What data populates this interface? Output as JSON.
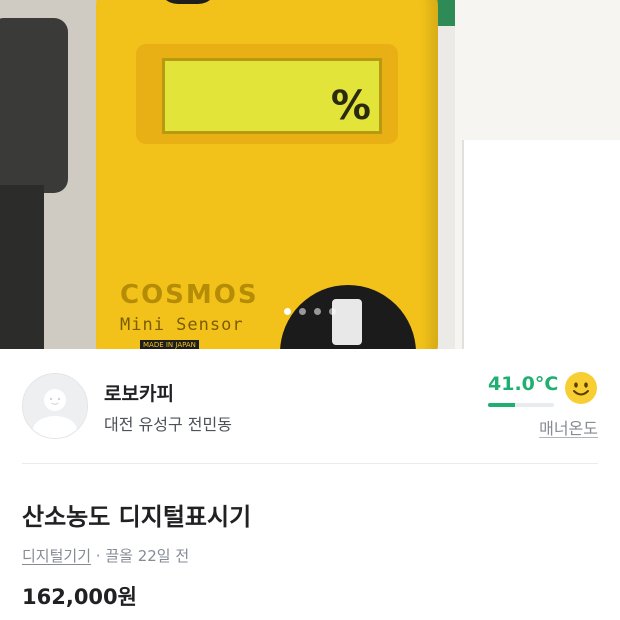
{
  "photo": {
    "device_brand": "COSMOS",
    "device_model": "Mini Sensor",
    "device_made": "MADE IN JAPAN",
    "lcd_unit": "%",
    "carousel_total": 4,
    "carousel_active_index": 0
  },
  "seller": {
    "nickname": "로보카피",
    "location": "대전 유성구 전민동",
    "manner_temp": "41.0°C",
    "manner_temp_fill_percent": 41,
    "manner_label": "매너온도",
    "accent_color": "#1faf70"
  },
  "item": {
    "title": "산소농도 디지털표시기",
    "category": "디지털기기",
    "meta_separator": " · ",
    "posted": "끌올 22일 전",
    "price": "162,000원"
  }
}
